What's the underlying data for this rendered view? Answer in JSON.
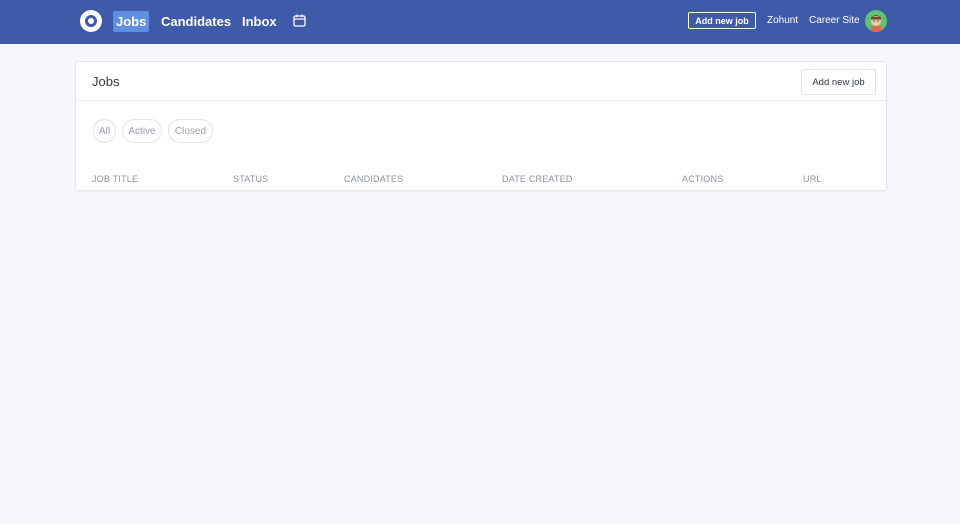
{
  "nav": {
    "items": [
      {
        "label": "Jobs",
        "active": true
      },
      {
        "label": "Candidates",
        "active": false
      },
      {
        "label": "Inbox",
        "active": false
      }
    ],
    "add_job_label": "Add new job",
    "company_label": "Zohunt",
    "career_site_label": "Career Site"
  },
  "card": {
    "title": "Jobs",
    "add_job_label": "Add new job",
    "filters": [
      "All",
      "Active",
      "Closed"
    ],
    "columns": [
      "JOB TITLE",
      "STATUS",
      "CANDIDATES",
      "DATE CREATED",
      "ACTIONS",
      "URL"
    ]
  },
  "colors": {
    "topbar": "#3f5aa8",
    "active_nav": "#5f8fde",
    "background": "#f5f7fb",
    "avatar": "#5ec46d"
  }
}
